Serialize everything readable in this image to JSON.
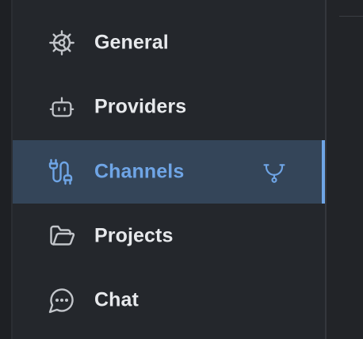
{
  "sidebar": {
    "items": [
      {
        "label": "General",
        "icon": "gear-icon",
        "active": false
      },
      {
        "label": "Providers",
        "icon": "robot-icon",
        "active": false
      },
      {
        "label": "Channels",
        "icon": "cable-plug-icon",
        "active": true,
        "trailing_icon": "webhook-icon"
      },
      {
        "label": "Projects",
        "icon": "folder-open-icon",
        "active": false
      },
      {
        "label": "Chat",
        "icon": "chat-bubble-icon",
        "active": false
      }
    ]
  },
  "colors": {
    "background": "#212327",
    "sidebar": "#24272c",
    "active_background": "#344559",
    "accent": "#6fa5e6",
    "text": "#e7e9ec",
    "icon": "#c2c5ca"
  }
}
